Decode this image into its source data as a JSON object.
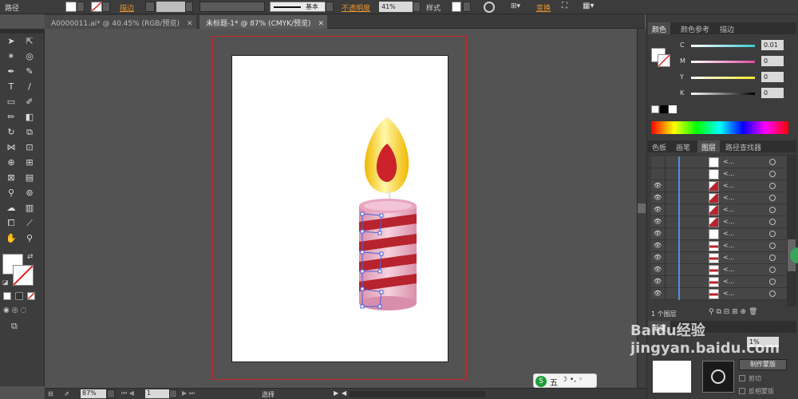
{
  "control_bar": {
    "path_label": "路径",
    "stroke_label": "描边",
    "stroke_style": "基本",
    "opacity_label": "不透明度",
    "opacity_value": "41%",
    "style_label": "样式",
    "transform_label": "变换"
  },
  "tabs": [
    {
      "label": "A0000011.ai* @ 40.45% (RGB/预览)"
    },
    {
      "label": "未标题-1* @ 87% (CMYK/预览)"
    }
  ],
  "color_panel": {
    "tabs": [
      "颜色",
      "颜色参考",
      "描边"
    ],
    "channels": [
      {
        "name": "C",
        "value": "0.01",
        "color": "#3fc9d3"
      },
      {
        "name": "M",
        "value": "0",
        "color": "#e04aa0"
      },
      {
        "name": "Y",
        "value": "0",
        "color": "#f0ea2a"
      },
      {
        "name": "K",
        "value": "0",
        "color": "#888888"
      }
    ]
  },
  "layers_panel": {
    "tabs": [
      "色板",
      "画笔",
      "图层",
      "路径查找器"
    ],
    "rows": [
      {
        "name": "<...",
        "visible": false,
        "thumb": "white"
      },
      {
        "name": "<...",
        "visible": false,
        "thumb": "white"
      },
      {
        "name": "<...",
        "visible": true,
        "thumb": "red"
      },
      {
        "name": "<...",
        "visible": true,
        "thumb": "red"
      },
      {
        "name": "<...",
        "visible": true,
        "thumb": "red"
      },
      {
        "name": "<...",
        "visible": true,
        "thumb": "red"
      },
      {
        "name": "<...",
        "visible": true,
        "thumb": "white"
      },
      {
        "name": "<...",
        "visible": true,
        "thumb": "stripe"
      },
      {
        "name": "<...",
        "visible": true,
        "thumb": "stripe"
      },
      {
        "name": "<...",
        "visible": true,
        "thumb": "stripe"
      },
      {
        "name": "<...",
        "visible": true,
        "thumb": "stripe"
      },
      {
        "name": "<...",
        "visible": true,
        "thumb": "stripe"
      }
    ],
    "layer_count": "1 个图层"
  },
  "transparency_panel": {
    "tab": "渐变",
    "opacity_value": "1%",
    "make_mask_button": "制作蒙版",
    "clip_label": "剪切",
    "invert_label": "反相蒙版"
  },
  "status_bar": {
    "zoom": "87%",
    "page": "1",
    "tool": "选择"
  },
  "ime_label": "五",
  "watermark": "Baidu经验 jingyan.baidu.com",
  "colors": {
    "flame_outer": "#f5cf12",
    "flame_inner": "#cc2229",
    "candle_body": "#e6a3bd",
    "candle_stripe": "#b7242e",
    "selection": "#4d5fe0",
    "artboard_bleed": "#c8292b"
  }
}
